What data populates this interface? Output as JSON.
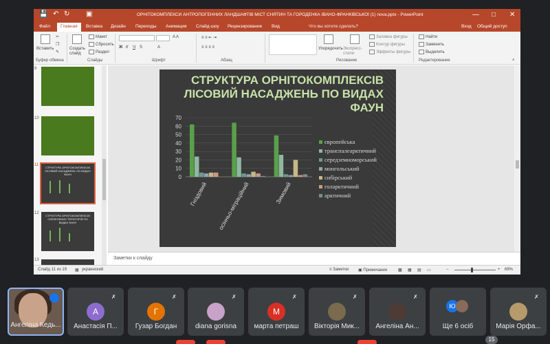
{
  "ppt": {
    "doc_title": "ОРНІТОКОМПЛЕКСИ АНТРОПОГЕННИХ ЛАНДШАФТІВ МІСТ СНЯТИН ТА ГОРОДЕНКА ІВАНО-ФРАНКІВСЬКОЇ (1) nova.pptx - PowerPoint",
    "menu_tabs": [
      "Файл",
      "Главная",
      "Вставка",
      "Дизайн",
      "Переходы",
      "Анимация",
      "Слайд-шоу",
      "Рецензирование",
      "Вид"
    ],
    "tell_me": "Что вы хотите сделать?",
    "login": "Вход",
    "share": "Общий доступ",
    "ribbon": {
      "paste": "Вставить",
      "new_slide": "Создать слайд",
      "layout": "Макет",
      "reset": "Сбросить",
      "section": "Раздел",
      "arrange": "Упорядочить",
      "quick_styles": "Экспресс-стили",
      "shape_fill": "Заливка фигуры",
      "shape_outline": "Контур фигуры",
      "shape_effects": "Эффекты фигуры",
      "find": "Найти",
      "replace": "Заменить",
      "select": "Выделить",
      "groups": [
        "Буфер обмена",
        "Слайды",
        "Шрифт",
        "Абзац",
        "Рисование",
        "Редактирование"
      ]
    },
    "thumbnails": [
      {
        "num": "9",
        "style": "green",
        "title": ""
      },
      {
        "num": "10",
        "style": "green",
        "title": ""
      },
      {
        "num": "11",
        "style": "dark",
        "title": "СТРУКТУРА ОРНІТОКОМПЛЕКСІВ ЛІСОВИЙ НАСАДЖЕНЬ ПО ВИДАХ ФАУН",
        "selected": true
      },
      {
        "num": "12",
        "style": "dark",
        "title": "СТРУКТУРА ОРНІТОКОМПЛЕКСІВ ОЗЕЛЕНЕНИХ ТЕРИТОРІЙ ПО ВИДАХ ФАУН"
      },
      {
        "num": "13",
        "style": "dark",
        "title": ""
      }
    ],
    "slide": {
      "title_lines": [
        "СТРУКТУРА ОРНІТОКОМПЛЕКСІВ",
        "ЛІСОВИЙ НАСАДЖЕНЬ ПО ВИДАХ",
        "ФАУН"
      ]
    },
    "notes_placeholder": "Заметки к слайду",
    "status": {
      "slide": "Слайд 11 из 19",
      "language": "украинский",
      "notes": "Заметки",
      "comments": "Примечания",
      "zoom": "69%"
    },
    "colors": {
      "accent": "#b7472a",
      "slide_bg": "#3a3a3a",
      "title_green": "#c7e2a8"
    }
  },
  "chart_data": {
    "type": "bar",
    "title": "СТРУКТУРА ОРНІТОКОМПЛЕКСІВ ЛІСОВИЙ НАСАДЖЕНЬ ПО ВИДАХ ФАУН",
    "categories": [
      "Гніздовий",
      "осінньо-міграційний",
      "Зимовий"
    ],
    "ylim": [
      0,
      70
    ],
    "yticks": [
      0,
      10,
      20,
      30,
      40,
      50,
      60,
      70
    ],
    "grid": true,
    "legend": "right",
    "series": [
      {
        "name": "європейська",
        "color": "#5aa04a",
        "values": [
          62,
          64,
          49
        ]
      },
      {
        "name": "транспалеарктичний",
        "color": "#8fb8a0",
        "values": [
          24,
          23,
          26
        ]
      },
      {
        "name": "середземноморський",
        "color": "#6c9a8e",
        "values": [
          5,
          4,
          3
        ]
      },
      {
        "name": "монгольський",
        "color": "#96a3b0",
        "values": [
          4,
          3,
          2
        ]
      },
      {
        "name": "сибірський",
        "color": "#c5b88a",
        "values": [
          5,
          6,
          20
        ]
      },
      {
        "name": "голарктичний",
        "color": "#c89a86",
        "values": [
          5,
          4,
          2
        ]
      },
      {
        "name": "арктичний",
        "color": "#7b8f8a",
        "values": [
          0,
          1,
          3
        ]
      }
    ]
  },
  "participants": [
    {
      "name": "Ангеліна Кедь...",
      "self": true
    },
    {
      "name": "Анастасія П...",
      "initial": "А",
      "color": "#8e6ccf"
    },
    {
      "name": "Гузар Богдан",
      "initial": "Г",
      "color": "#e37400"
    },
    {
      "name": "diana gorisna",
      "photo": true,
      "color": "#c8a2c8"
    },
    {
      "name": "марта петраш",
      "initial": "М",
      "color": "#d93025"
    },
    {
      "name": "Вікторія Мик...",
      "photo": true,
      "color": "#7a6a4e"
    },
    {
      "name": "Ангеліна Ан...",
      "photo": true,
      "color": "#4e3b35"
    },
    {
      "name": "Ще 6 осіб",
      "more": true
    },
    {
      "name": "Марія Орфа...",
      "photo": true,
      "color": "#b79a6a"
    }
  ],
  "more_badge": "15"
}
